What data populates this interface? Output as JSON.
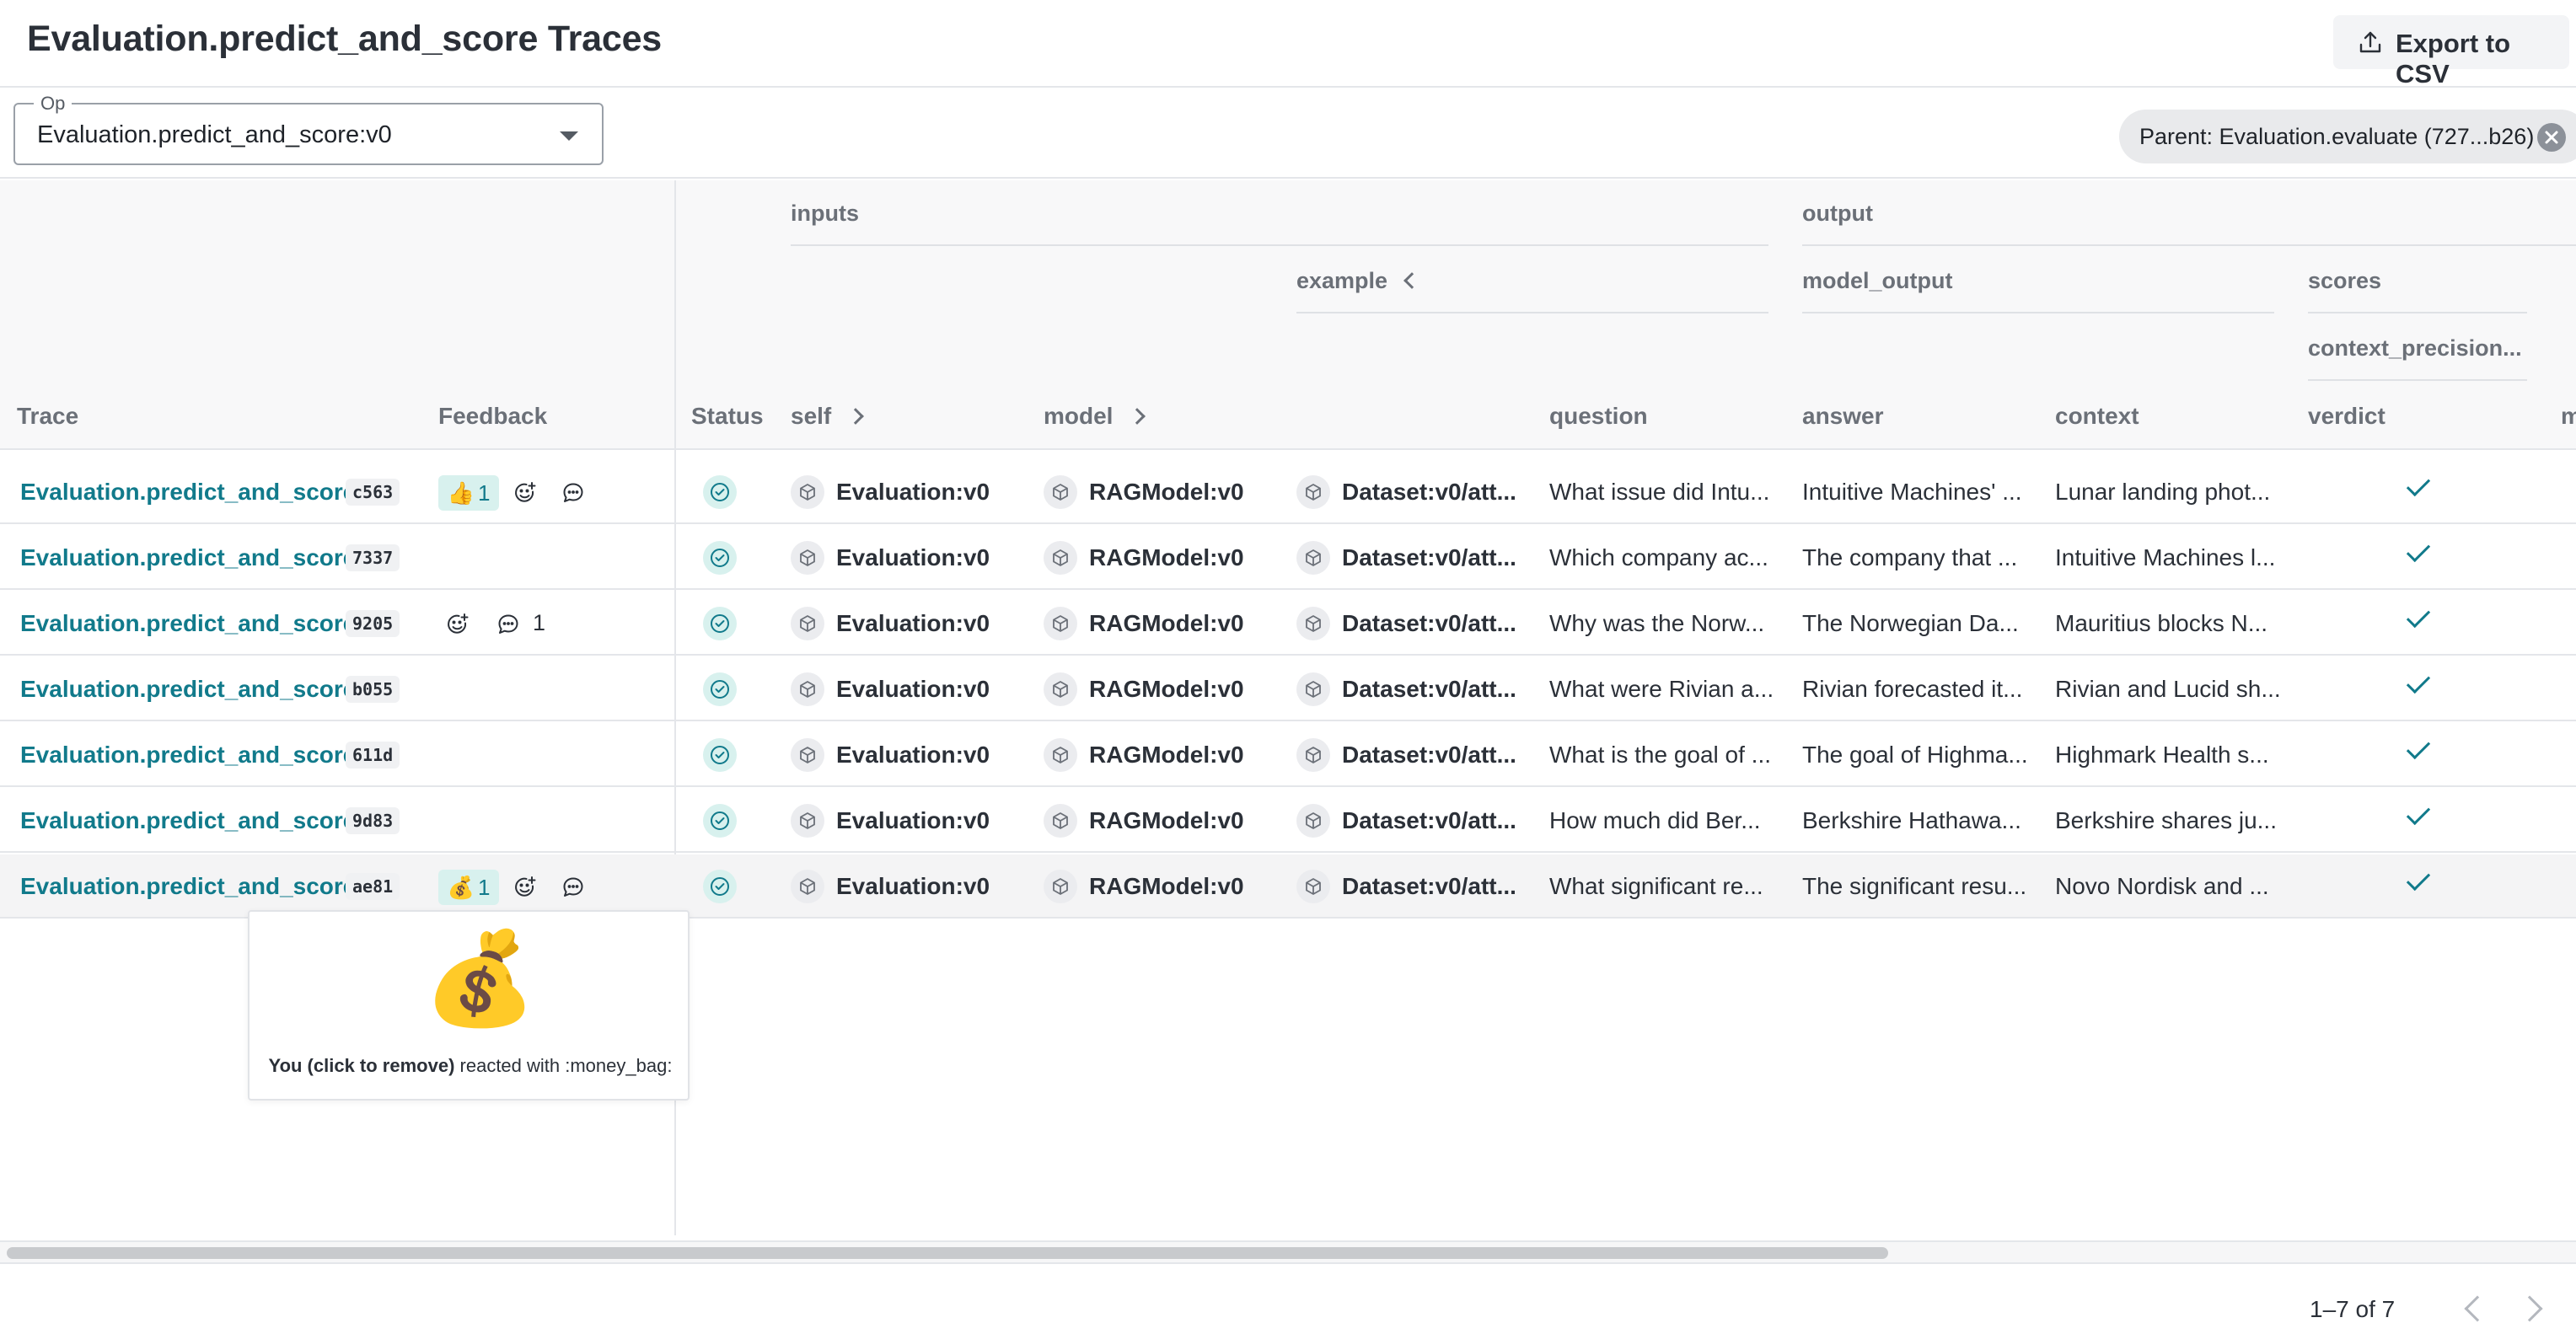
{
  "header": {
    "title": "Evaluation.predict_and_score Traces",
    "export_label": "Export to CSV"
  },
  "filters": {
    "op_legend": "Op",
    "op_value": "Evaluation.predict_and_score:v0",
    "parent_chip": "Parent: Evaluation.evaluate (727...b26)"
  },
  "group_headers": {
    "inputs": "inputs",
    "output": "output",
    "example": "example",
    "model_output": "model_output",
    "scores": "scores",
    "context_precision": "context_precision..."
  },
  "columns": {
    "trace": "Trace",
    "feedback": "Feedback",
    "status": "Status",
    "self": "self",
    "model": "model",
    "question": "question",
    "answer": "answer",
    "context": "context",
    "verdict": "verdict",
    "more": "m"
  },
  "rows": [
    {
      "trace": "Evaluation.predict_and_score",
      "id": "c563",
      "reaction": "👍",
      "reaction_count": "1",
      "comment_count": "",
      "self": "Evaluation:v0",
      "model": "RAGModel:v0",
      "example": "Dataset:v0/att...",
      "question": "What issue did Intu...",
      "answer": "Intuitive Machines' ...",
      "context": "Lunar landing phot..."
    },
    {
      "trace": "Evaluation.predict_and_score",
      "id": "7337",
      "reaction": "",
      "reaction_count": "",
      "comment_count": "",
      "self": "Evaluation:v0",
      "model": "RAGModel:v0",
      "example": "Dataset:v0/att...",
      "question": "Which company ac...",
      "answer": "The company that ...",
      "context": "Intuitive Machines l..."
    },
    {
      "trace": "Evaluation.predict_and_score",
      "id": "9205",
      "reaction": "",
      "reaction_count": "",
      "comment_count": "1",
      "self": "Evaluation:v0",
      "model": "RAGModel:v0",
      "example": "Dataset:v0/att...",
      "question": "Why was the Norw...",
      "answer": "The Norwegian Da...",
      "context": "Mauritius blocks N..."
    },
    {
      "trace": "Evaluation.predict_and_score",
      "id": "b055",
      "reaction": "",
      "reaction_count": "",
      "comment_count": "",
      "self": "Evaluation:v0",
      "model": "RAGModel:v0",
      "example": "Dataset:v0/att...",
      "question": "What were Rivian a...",
      "answer": "Rivian forecasted it...",
      "context": "Rivian and Lucid sh..."
    },
    {
      "trace": "Evaluation.predict_and_score",
      "id": "611d",
      "reaction": "",
      "reaction_count": "",
      "comment_count": "",
      "self": "Evaluation:v0",
      "model": "RAGModel:v0",
      "example": "Dataset:v0/att...",
      "question": "What is the goal of ...",
      "answer": "The goal of Highma...",
      "context": "Highmark Health s..."
    },
    {
      "trace": "Evaluation.predict_and_score",
      "id": "9d83",
      "reaction": "",
      "reaction_count": "",
      "comment_count": "",
      "self": "Evaluation:v0",
      "model": "RAGModel:v0",
      "example": "Dataset:v0/att...",
      "question": "How much did Ber...",
      "answer": "Berkshire Hathawa...",
      "context": "Berkshire shares ju..."
    },
    {
      "trace": "Evaluation.predict_and_score",
      "id": "ae81",
      "reaction": "💰",
      "reaction_count": "1",
      "comment_count": "",
      "self": "Evaluation:v0",
      "model": "RAGModel:v0",
      "example": "Dataset:v0/att...",
      "question": "What significant re...",
      "answer": "The significant resu...",
      "context": "Novo Nordisk and ..."
    }
  ],
  "tooltip": {
    "emoji": "💰",
    "user": "You (click to remove)",
    "text": " reacted with :money_bag:"
  },
  "pager": {
    "range": "1–7 of 7"
  },
  "colors": {
    "accent": "#117a8b",
    "chip_bg": "#d8f1ee"
  },
  "icons": {
    "export": "upload-icon",
    "status": "check-circle-icon",
    "object": "cube-icon",
    "add_reaction": "add-emoji-icon",
    "comment": "comment-icon",
    "verdict": "checkmark-icon"
  }
}
